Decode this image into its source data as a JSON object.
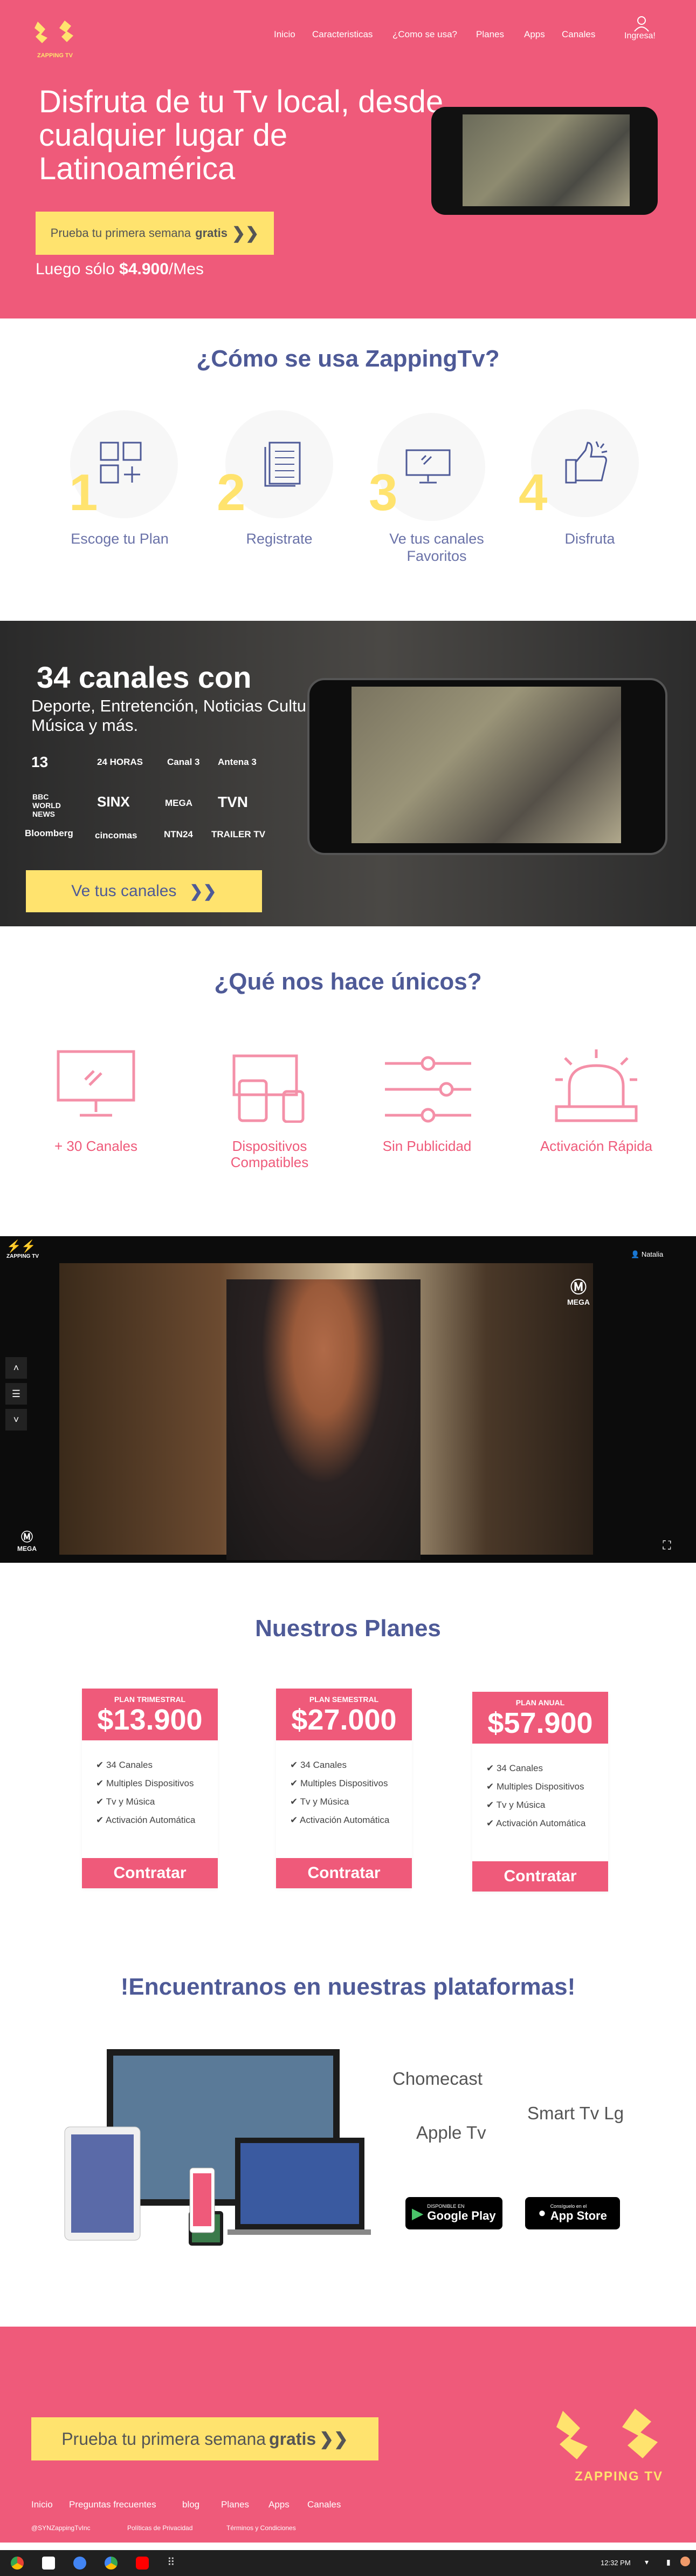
{
  "header": {
    "brand": "ZAPPING TV",
    "nav": [
      "Inicio",
      "Caracteristicas",
      "¿Como se usa?",
      "Planes",
      "Apps",
      "Canales"
    ],
    "login_label": "Ingresa!"
  },
  "hero": {
    "title": "Disfruta de tu Tv local, desde cualquier lugar de Latinoamérica",
    "trial_prefix": "Prueba tu primera semana",
    "trial_bold": "gratis",
    "price_prefix": "Luego sólo",
    "price_value": "$4.900",
    "price_suffix": "/Mes"
  },
  "how": {
    "title": "¿Cómo se usa ZappingTv?",
    "steps": [
      {
        "num": "1",
        "label": "Escoge tu Plan"
      },
      {
        "num": "2",
        "label": "Registrate"
      },
      {
        "num": "3",
        "label": "Ve tus canales Favoritos"
      },
      {
        "num": "4",
        "label": "Disfruta"
      }
    ]
  },
  "channels": {
    "title": "34 canales con",
    "subtitle": "Deporte, Entretención, Noticias Cultura Música y más.",
    "logos": [
      "13",
      "24 HORAS",
      "Canal 3",
      "Antena 3",
      "BBC WORLD NEWS",
      "SINX",
      "MEGA",
      "TVN",
      "Bloomberg",
      "cincomas",
      "NTN24",
      "TRAILER TV"
    ],
    "button_label": "Ve tus canales"
  },
  "unique": {
    "title": "¿Qué nos hace únicos?",
    "features": [
      "+ 30 Canales",
      "Dispositivos Compatibles",
      "Sin Publicidad",
      "Activación Rápida"
    ]
  },
  "video": {
    "brand": "ZAPPING TV",
    "user_label": "Natalia",
    "watermark": "MEGA",
    "channel_badge": "MEGA"
  },
  "plans": {
    "title": "Nuestros Planes",
    "items": [
      {
        "name": "PLAN TRIMESTRAL",
        "price": "$13.900",
        "features": [
          "34 Canales",
          "Multiples Dispositivos",
          "Tv y Música",
          "Activación Automática"
        ],
        "button": "Contratar"
      },
      {
        "name": "PLAN SEMESTRAL",
        "price": "$27.000",
        "features": [
          "34 Canales",
          "Multiples Dispositivos",
          "Tv y Música",
          "Activación Automática"
        ],
        "button": "Contratar"
      },
      {
        "name": "PLAN ANUAL",
        "price": "$57.900",
        "features": [
          "34 Canales",
          "Multiples Dispositivos",
          "Tv y Música",
          "Activación Automática"
        ],
        "button": "Contratar"
      }
    ]
  },
  "platforms": {
    "title": "!Encuentranos en nuestras plataformas!",
    "names": [
      "Chomecast",
      "Smart Tv Lg",
      "Apple Tv"
    ],
    "google_play_small": "DISPONIBLE EN",
    "google_play": "Google Play",
    "app_store_small": "Consíguelo en el",
    "app_store": "App Store"
  },
  "footer": {
    "trial_prefix": "Prueba tu primera semana",
    "trial_bold": "gratis",
    "links": [
      "Inicio",
      "Preguntas frecuentes",
      "blog",
      "Planes",
      "Apps",
      "Canales"
    ],
    "small_links": [
      "@SYNZappingTvInc",
      "Políticas de Privacidad",
      "Términos y Condiciones"
    ],
    "brand": "ZAPPING TV"
  },
  "taskbar": {
    "time": "12:32 PM"
  },
  "colors": {
    "brand_pink": "#ef5a7a",
    "accent_yellow": "#ffe36e",
    "title_blue": "#4e5a97"
  }
}
